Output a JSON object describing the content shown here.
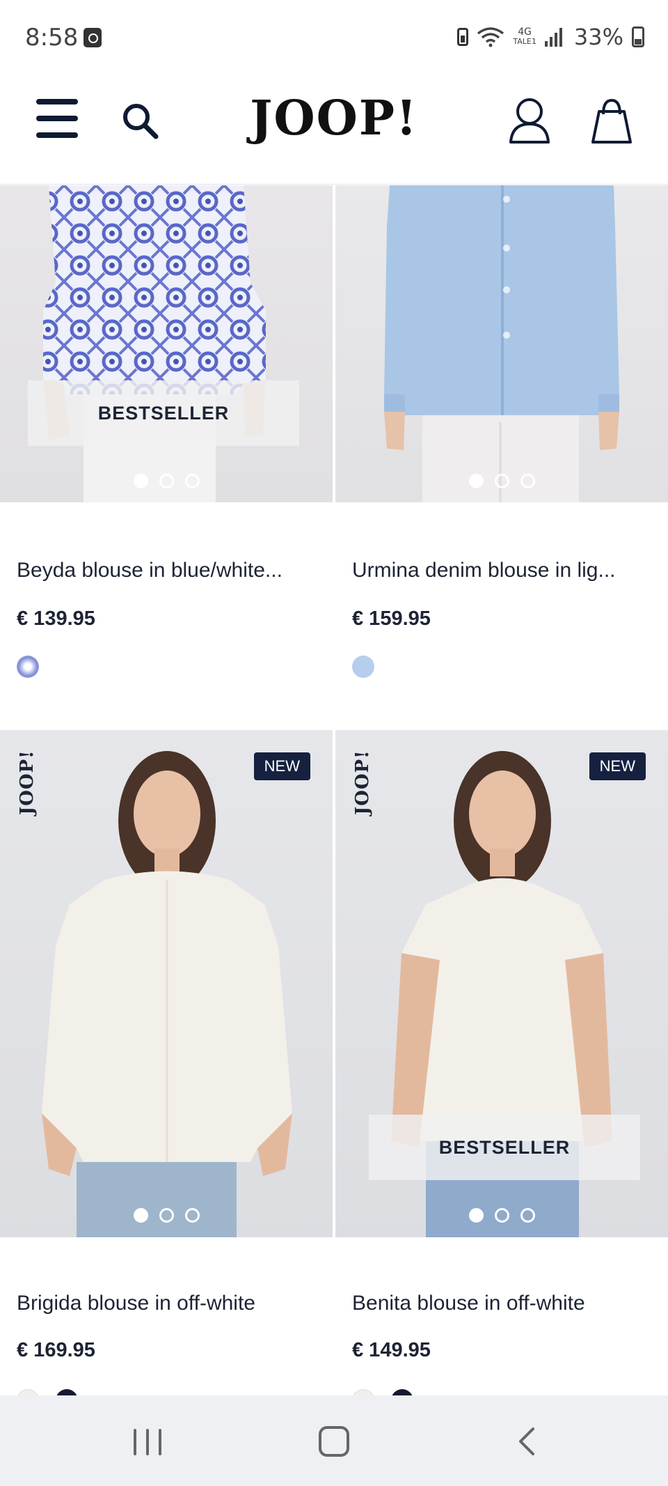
{
  "status_bar": {
    "time": "8:58",
    "network_type": "4G",
    "network_sub": "TALE1",
    "battery_percent": "33%"
  },
  "header": {
    "logo": "JOOP!",
    "icons": [
      "menu-icon",
      "search-icon",
      "account-icon",
      "shopping-bag-icon"
    ]
  },
  "products": [
    {
      "name": "Beyda blouse in blue/white...",
      "price": "€ 139.95",
      "badge": "BESTSELLER",
      "image_dots": 3,
      "active_dot": 1,
      "swatches": [
        "#c9d3ee"
      ]
    },
    {
      "name": "Urmina denim blouse in lig...",
      "price": "€ 159.95",
      "badge": "",
      "image_dots": 3,
      "active_dot": 1,
      "swatches": [
        "#b7cdee"
      ]
    },
    {
      "name": "Brigida blouse in off-white",
      "price": "€ 169.95",
      "badge": "NEW",
      "side_logo": "JOOP!",
      "image_dots": 3,
      "active_dot": 1,
      "swatches": [
        "#f1efeb",
        "#111a2e"
      ]
    },
    {
      "name": "Benita blouse in off-white",
      "price": "€ 149.95",
      "badge": "NEW",
      "badge2": "BESTSELLER",
      "side_logo": "JOOP!",
      "image_dots": 3,
      "active_dot": 1,
      "swatches": [
        "#f1efeb",
        "#111a2e"
      ]
    }
  ],
  "colors": {
    "brand_navy": "#15213f",
    "text": "#1c2434",
    "nav_bg": "#eef0f4"
  }
}
